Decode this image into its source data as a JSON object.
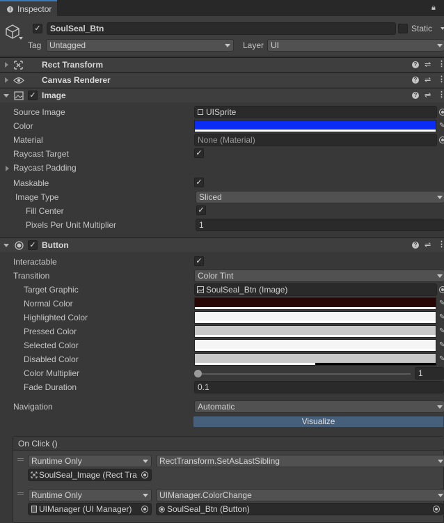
{
  "tab": {
    "title": "Inspector",
    "info_icon": "info-icon",
    "lock_icon": "lock-icon"
  },
  "header": {
    "object_name": "SoulSeal_Btn",
    "static_label": "Static",
    "tag_label": "Tag",
    "tag_value": "Untagged",
    "layer_label": "Layer",
    "layer_value": "UI"
  },
  "components": {
    "rect_transform": {
      "title": "Rect Transform"
    },
    "canvas_renderer": {
      "title": "Canvas Renderer"
    },
    "image": {
      "title": "Image",
      "source_image_label": "Source Image",
      "source_image_value": "UISprite",
      "color_label": "Color",
      "color_value": "#0a2cf5",
      "material_label": "Material",
      "material_value": "None (Material)",
      "raycast_target_label": "Raycast Target",
      "raycast_padding_label": "Raycast Padding",
      "maskable_label": "Maskable",
      "image_type_label": "Image Type",
      "image_type_value": "Sliced",
      "fill_center_label": "Fill Center",
      "ppu_label": "Pixels Per Unit Multiplier",
      "ppu_value": "1"
    },
    "button": {
      "title": "Button",
      "interactable_label": "Interactable",
      "transition_label": "Transition",
      "transition_value": "Color Tint",
      "target_graphic_label": "Target Graphic",
      "target_graphic_value": "SoulSeal_Btn (Image)",
      "normal_color_label": "Normal Color",
      "normal_color_value": "#2a0707",
      "highlighted_color_label": "Highlighted Color",
      "highlighted_color_value": "#f5f5f5",
      "pressed_color_label": "Pressed Color",
      "pressed_color_value": "#c8c8c8",
      "selected_color_label": "Selected Color",
      "selected_color_value": "#f5f5f5",
      "disabled_color_label": "Disabled Color",
      "disabled_color_value": "#c8c8c8",
      "color_multiplier_label": "Color Multiplier",
      "color_multiplier_value": "1",
      "fade_duration_label": "Fade Duration",
      "fade_duration_value": "0.1",
      "navigation_label": "Navigation",
      "navigation_value": "Automatic",
      "visualize_label": "Visualize"
    }
  },
  "on_click": {
    "title": "On Click ()",
    "entries": [
      {
        "runtime": "Runtime Only",
        "function": "RectTransform.SetAsLastSibling",
        "object": "SoulSeal_Image (Rect Tra"
      },
      {
        "runtime": "Runtime Only",
        "function": "UIManager.ColorChange",
        "object": "UIManager (UI Manager)",
        "argument": "SoulSeal_Btn (Button)"
      }
    ]
  }
}
